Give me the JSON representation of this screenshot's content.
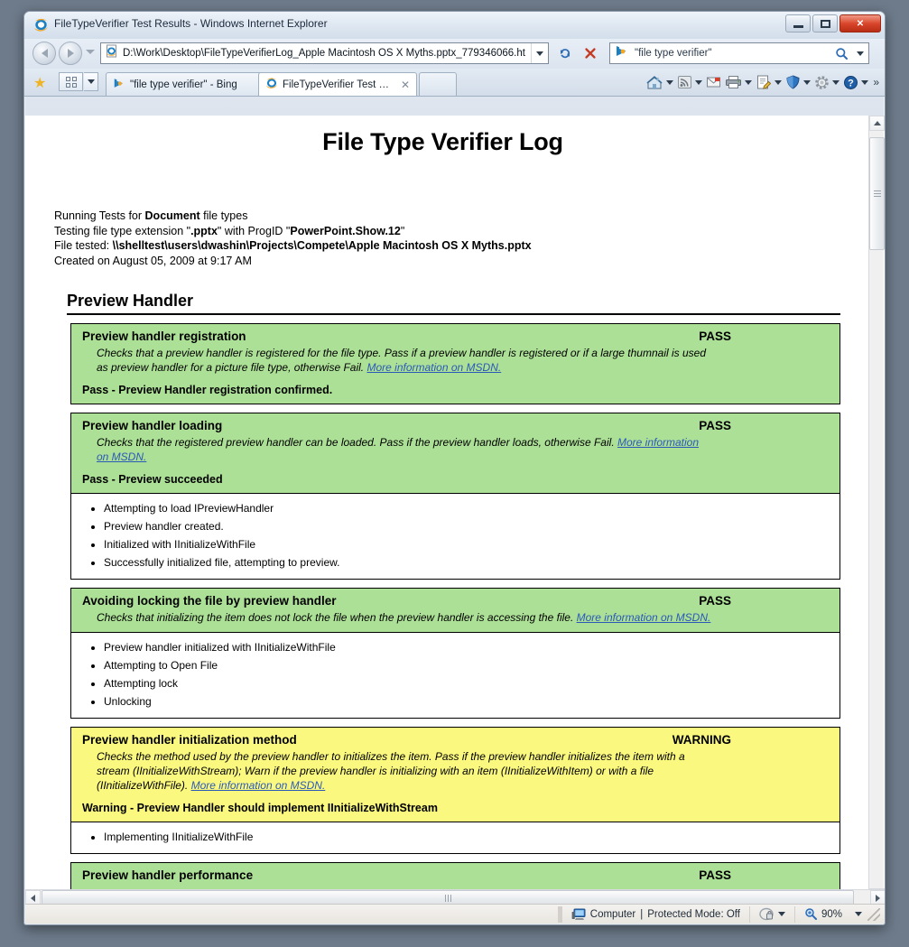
{
  "window": {
    "title": "FileTypeVerifier Test Results - Windows Internet Explorer",
    "icon": "internet-explorer-icon",
    "minimize_label": "Minimize",
    "maximize_label": "Maximize",
    "close_label": "✕"
  },
  "nav": {
    "back_label": "Back",
    "forward_label": "Forward",
    "recent_pages_label": "Recent Pages",
    "address": {
      "value": "D:\\Work\\Desktop\\FileTypeVerifierLog_Apple Macintosh OS X Myths.pptx_779346066.ht",
      "icon": "page-icon"
    },
    "refresh_label": "↻",
    "stop_label": "✕",
    "search": {
      "value": "\"file type verifier\"",
      "placeholder": "Search",
      "provider_icon": "bing-icon",
      "go_label": "Search",
      "dropdown_label": "Search options"
    }
  },
  "tabs": {
    "favorites_label": "★",
    "quick_tabs_label": "Quick Tabs",
    "tab_list_label": "Tab List",
    "items": [
      {
        "label": "\"file type verifier\" - Bing",
        "icon": "bing-icon",
        "active": false,
        "close": "✕"
      },
      {
        "label": "FileTypeVerifier Test Re...",
        "icon": "internet-explorer-icon",
        "active": true,
        "close": "✕"
      }
    ],
    "new_tab_label": ""
  },
  "command_bar": {
    "items": [
      {
        "name": "home-icon",
        "label": "Home"
      },
      {
        "name": "rss-feed-icon",
        "label": "Feeds"
      },
      {
        "name": "mail-icon",
        "label": "Read Mail"
      },
      {
        "name": "print-icon",
        "label": "Print"
      },
      {
        "name": "page-icon",
        "label": "Page"
      },
      {
        "name": "safety-shield-icon",
        "label": "Safety"
      },
      {
        "name": "tools-gear-icon",
        "label": "Tools"
      },
      {
        "name": "help-icon",
        "label": "Help"
      }
    ],
    "overflow_label": "»"
  },
  "document": {
    "title": "File Type Verifier Log",
    "meta": {
      "line1_pre": "Running Tests for ",
      "line1_bold": "Document",
      "line1_post": " file types",
      "line2_pre": "Testing file type extension \"",
      "line2_bold1": ".pptx",
      "line2_mid": "\" with ProgID \"",
      "line2_bold2": "PowerPoint.Show.12",
      "line2_post": "\"",
      "line3_pre": "File tested: ",
      "line3_bold": "\\\\shelltest\\users\\dwashin\\Projects\\Compete\\Apple Macintosh OS X Myths.pptx",
      "line4": "Created on August 05, 2009 at 9:17 AM"
    },
    "section_heading": "Preview Handler",
    "link_text": "More information on MSDN.",
    "cards": [
      {
        "name": "Preview handler registration",
        "status": "PASS",
        "state": "pass",
        "desc_before": "Checks that a preview handler is registered for the file type. Pass if a preview handler is registered or if a large thumnail is used as preview handler for a picture file type, otherwise Fail. ",
        "link": "More information on MSDN.",
        "result": "Pass - Preview Handler registration confirmed.",
        "log": []
      },
      {
        "name": "Preview handler loading",
        "status": "PASS",
        "state": "pass",
        "desc_before": "Checks that the registered preview handler can be loaded. Pass if the preview handler loads, otherwise Fail. ",
        "link": "More information on MSDN.",
        "result": "Pass - Preview succeeded",
        "log": [
          "Attempting to load IPreviewHandler",
          "Preview handler created.",
          "Initialized with IInitializeWithFile",
          "Successfully initialized file, attempting to preview."
        ]
      },
      {
        "name": "Avoiding locking the file by preview handler",
        "status": "PASS",
        "state": "pass",
        "desc_before": "Checks that initializing the item does not lock the file when the preview handler is accessing the file. ",
        "link": "More information on MSDN.",
        "result": "",
        "log": [
          "Preview handler initialized with IInitializeWithFile",
          "Attempting to Open File",
          "Attempting lock",
          "Unlocking"
        ]
      },
      {
        "name": "Preview handler initialization method",
        "status": "WARNING",
        "state": "warn",
        "desc_before": "Checks the method used by the preview handler to initializes the item. Pass if the preview handler initializes the item with a stream (IInitializeWithStream); Warn if the preview handler is initializing with an item (IInitializeWithItem) or with a file (IInitializeWithFile). ",
        "link": "More information on MSDN.",
        "result": "Warning - Preview Handler should implement IInitializeWithStream",
        "log": [
          "Implementing IInitializeWithFile"
        ]
      },
      {
        "name": "Preview handler performance",
        "status": "PASS",
        "state": "pass",
        "desc_before": "",
        "link": "",
        "result": "",
        "log": []
      }
    ]
  },
  "status_bar": {
    "left_text": "",
    "zone": "Computer",
    "separator": "|",
    "protected_mode": "Protected Mode: Off",
    "zone_icon": "computer-icon",
    "privacy_icon": "privacy-lock-icon",
    "zoom_icon": "zoom-magnifier-icon",
    "zoom_level": "90%"
  },
  "colors": {
    "pass_green": "#ace096",
    "warning_yellow": "#faf87f",
    "link_blue": "#2b59b8",
    "close_red": "#d8452a"
  }
}
